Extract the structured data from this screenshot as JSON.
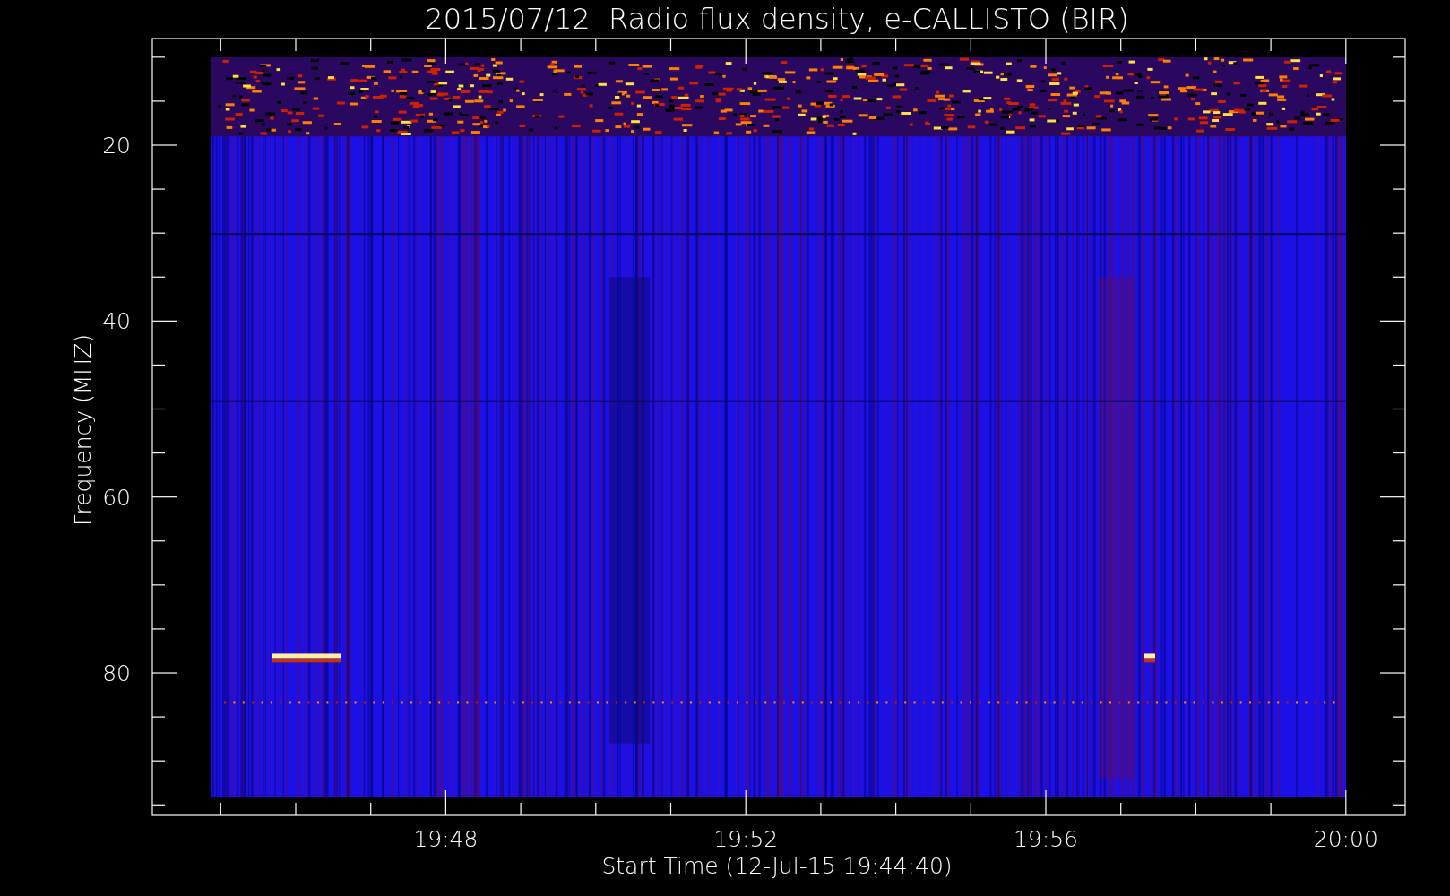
{
  "title": "2015/07/12  Radio flux density, e-CALLISTO (BIR)",
  "y_axis": {
    "label": "Frequency (MHZ)",
    "tick_labels": [
      "20",
      "40",
      "60",
      "80"
    ]
  },
  "x_axis": {
    "label": "Start Time (12-Jul-15 19:44:40)",
    "tick_labels": [
      "19:48",
      "19:52",
      "19:56",
      "20:00"
    ]
  }
}
